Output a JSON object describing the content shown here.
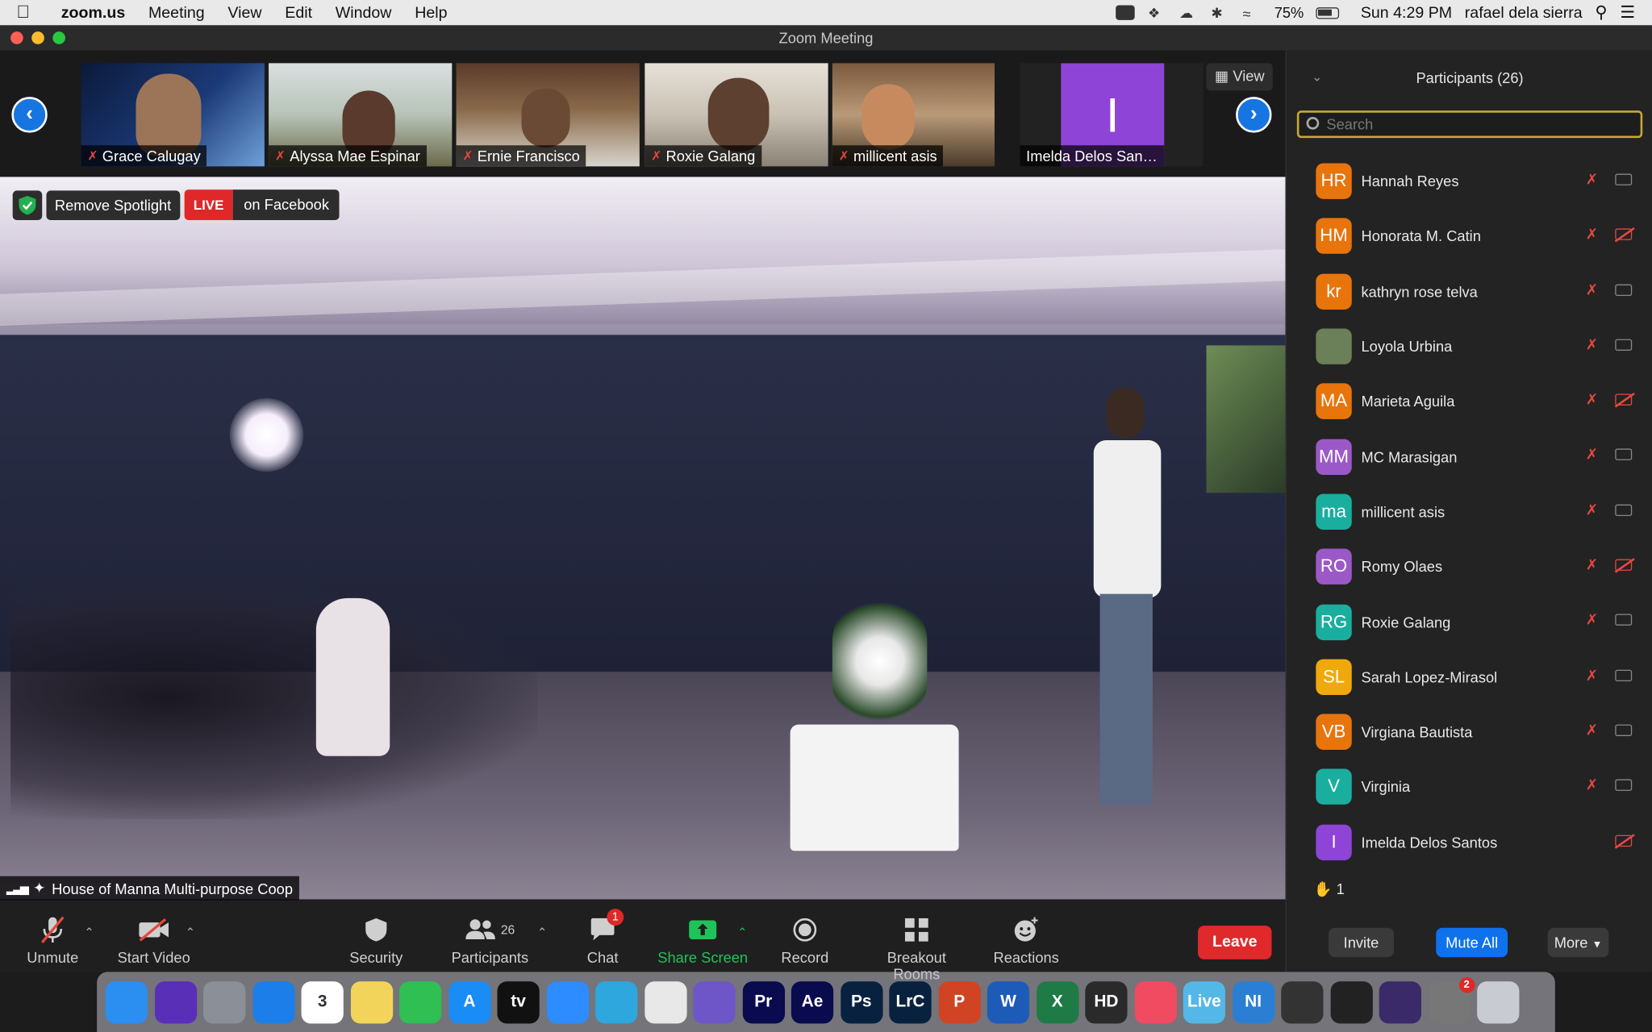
{
  "menubar": {
    "app": "zoom.us",
    "items": [
      "Meeting",
      "View",
      "Edit",
      "Window",
      "Help"
    ],
    "battery": "75%",
    "clock": "Sun 4:29 PM",
    "user": "rafael dela sierra"
  },
  "window": {
    "title": "Zoom Meeting"
  },
  "gallery": {
    "view_label": "View",
    "tiles": [
      {
        "name": "Grace Calugay",
        "muted": true
      },
      {
        "name": "Alyssa Mae Espinar",
        "muted": true
      },
      {
        "name": "Ernie Francisco",
        "muted": true
      },
      {
        "name": "Roxie Galang",
        "muted": true
      },
      {
        "name": "millicent asis",
        "muted": true
      },
      {
        "name": "Imelda Delos San…",
        "muted": false,
        "initial": "I"
      }
    ]
  },
  "spotlight": {
    "remove_label": "Remove Spotlight",
    "live_label": "LIVE",
    "live_target": "on Facebook",
    "speaker_name": "House of Manna Multi-purpose Coop"
  },
  "toolbar": {
    "unmute": "Unmute",
    "start_video": "Start Video",
    "security": "Security",
    "participants": "Participants",
    "participants_count": "26",
    "chat": "Chat",
    "chat_badge": "1",
    "share_screen": "Share Screen",
    "record": "Record",
    "breakout": "Breakout Rooms",
    "reactions": "Reactions",
    "leave": "Leave"
  },
  "panel": {
    "title": "Participants (26)",
    "search_placeholder": "Search",
    "participants": [
      {
        "initials": "HR",
        "name": "Hannah Reyes",
        "color": "#e8740c",
        "mic_muted": true,
        "cam_off": false
      },
      {
        "initials": "HM",
        "name": "Honorata M. Catin",
        "color": "#e8740c",
        "mic_muted": true,
        "cam_off": true
      },
      {
        "initials": "kr",
        "name": "kathryn rose telva",
        "color": "#e8740c",
        "mic_muted": true,
        "cam_off": false
      },
      {
        "initials": "",
        "name": "Loyola Urbina",
        "color": "#6b7f58",
        "mic_muted": true,
        "cam_off": false
      },
      {
        "initials": "MA",
        "name": "Marieta Aguila",
        "color": "#e8740c",
        "mic_muted": true,
        "cam_off": true
      },
      {
        "initials": "MM",
        "name": "MC Marasigan",
        "color": "#9b59c7",
        "mic_muted": true,
        "cam_off": false
      },
      {
        "initials": "ma",
        "name": "millicent asis",
        "color": "#1aae9f",
        "mic_muted": true,
        "cam_off": false
      },
      {
        "initials": "RO",
        "name": "Romy Olaes",
        "color": "#9b59c7",
        "mic_muted": true,
        "cam_off": true
      },
      {
        "initials": "RG",
        "name": "Roxie Galang",
        "color": "#1aae9f",
        "mic_muted": true,
        "cam_off": false
      },
      {
        "initials": "SL",
        "name": "Sarah Lopez-Mirasol",
        "color": "#f0a90c",
        "mic_muted": true,
        "cam_off": false
      },
      {
        "initials": "VB",
        "name": "Virgiana Bautista",
        "color": "#e8740c",
        "mic_muted": true,
        "cam_off": false
      },
      {
        "initials": "V",
        "name": "Virginia",
        "color": "#1aae9f",
        "mic_muted": true,
        "cam_off": false
      },
      {
        "initials": "I",
        "name": "Imelda Delos Santos",
        "color": "#8e44d6",
        "mic_muted": false,
        "cam_off": true
      }
    ],
    "raised_hands": "1",
    "invite": "Invite",
    "mute_all": "Mute All",
    "more": "More"
  },
  "dock": {
    "apps": [
      {
        "name": "finder",
        "label": "",
        "color": "#2a8ff0"
      },
      {
        "name": "siri",
        "label": "",
        "color": "#5a2fb8"
      },
      {
        "name": "launchpad",
        "label": "",
        "color": "#8b8f98"
      },
      {
        "name": "safari",
        "label": "",
        "color": "#1c7ee8"
      },
      {
        "name": "calendar",
        "label": "3",
        "color": "#ffffff"
      },
      {
        "name": "notes",
        "label": "",
        "color": "#f3d45a"
      },
      {
        "name": "facetime",
        "label": "",
        "color": "#2fbf52"
      },
      {
        "name": "app-store",
        "label": "A",
        "color": "#1a8cf5"
      },
      {
        "name": "apple-tv",
        "label": "tv",
        "color": "#111111"
      },
      {
        "name": "zoom",
        "label": "",
        "color": "#2d8cff"
      },
      {
        "name": "telegram",
        "label": "",
        "color": "#2ea6de"
      },
      {
        "name": "chrome",
        "label": "",
        "color": "#e8e8e8"
      },
      {
        "name": "torrent",
        "label": "",
        "color": "#6e56c9"
      },
      {
        "name": "premiere",
        "label": "Pr",
        "color": "#0a0a4e"
      },
      {
        "name": "after-effects",
        "label": "Ae",
        "color": "#0a0a4e"
      },
      {
        "name": "photoshop",
        "label": "Ps",
        "color": "#07213f"
      },
      {
        "name": "lightroom-classic",
        "label": "LrC",
        "color": "#07213f"
      },
      {
        "name": "powerpoint",
        "label": "P",
        "color": "#d04423"
      },
      {
        "name": "word",
        "label": "W",
        "color": "#1d5bb8"
      },
      {
        "name": "excel",
        "label": "X",
        "color": "#1e7b45"
      },
      {
        "name": "hd-video",
        "label": "HD",
        "color": "#2a2a2a"
      },
      {
        "name": "music",
        "label": "",
        "color": "#f04b61"
      },
      {
        "name": "live",
        "label": "Live",
        "color": "#53b7e8"
      },
      {
        "name": "ni-app",
        "label": "NI",
        "color": "#2a7fd4"
      },
      {
        "name": "waveform",
        "label": "",
        "color": "#333333"
      },
      {
        "name": "final-cut",
        "label": "",
        "color": "#222222"
      },
      {
        "name": "action-app",
        "label": "",
        "color": "#3a2a6a"
      },
      {
        "name": "system-preferences",
        "label": "",
        "color": "#777777",
        "badge": "2"
      },
      {
        "name": "trash",
        "label": "",
        "color": "#c8ccd2"
      }
    ]
  }
}
